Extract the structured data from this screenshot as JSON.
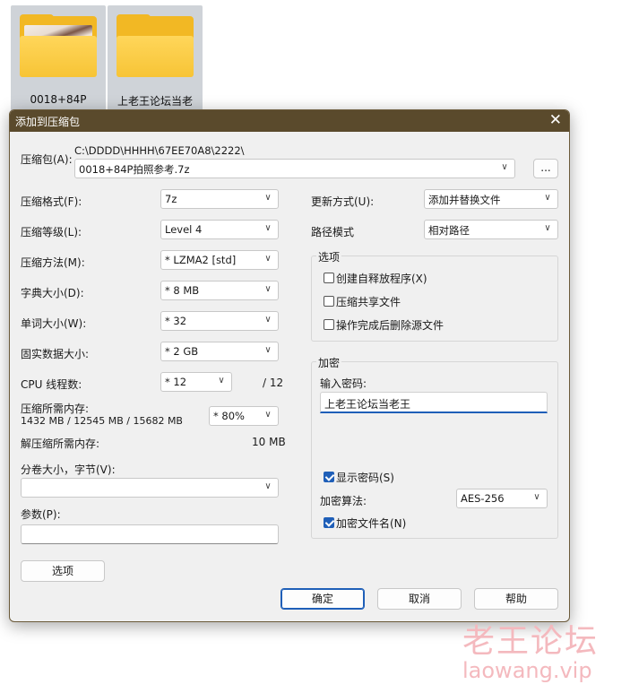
{
  "desktop": {
    "folders": [
      {
        "label": "0018+84P"
      },
      {
        "label": "上老王论坛当老"
      }
    ]
  },
  "dialog": {
    "title": "添加到压缩包",
    "close_glyph": "✕",
    "archive": {
      "label": "压缩包(A):",
      "path": "C:\\DDDD\\HHHH\\67EE70A8\\2222\\",
      "value": "0018+84P拍照参考.7z",
      "browse": "..."
    },
    "left": {
      "format": {
        "label": "压缩格式(F):",
        "value": "7z"
      },
      "level": {
        "label": "压缩等级(L):",
        "value": "Level 4"
      },
      "method": {
        "label": "压缩方法(M):",
        "value": "*  LZMA2 [std]"
      },
      "dict": {
        "label": "字典大小(D):",
        "value": "*  8 MB"
      },
      "word": {
        "label": "单词大小(W):",
        "value": "*  32"
      },
      "solid": {
        "label": "固实数据大小:",
        "value": "*  2 GB"
      },
      "threads": {
        "label": "CPU 线程数:",
        "value": "*  12",
        "total": "/ 12"
      },
      "mem_compress": {
        "label": "压缩所需内存:",
        "detail": "1432 MB / 12545 MB / 15682 MB",
        "value": "* 80%"
      },
      "mem_decompress": {
        "label": "解压缩所需内存:",
        "value": "10 MB"
      },
      "volume": {
        "label": "分卷大小，字节(V):",
        "value": ""
      },
      "params": {
        "label": "参数(P):",
        "value": ""
      },
      "options_button": "选项"
    },
    "right": {
      "update": {
        "label": "更新方式(U):",
        "value": "添加并替换文件"
      },
      "path_mode": {
        "label": "路径模式",
        "value": "相对路径"
      },
      "options_group": {
        "title": "选项",
        "items": [
          {
            "label": "创建自释放程序(X)",
            "checked": false
          },
          {
            "label": "压缩共享文件",
            "checked": false
          },
          {
            "label": "操作完成后删除源文件",
            "checked": false
          }
        ]
      },
      "encrypt_group": {
        "title": "加密",
        "password_label": "输入密码:",
        "password_value": "上老王论坛当老王",
        "show_password": {
          "label": "显示密码(S)",
          "checked": true
        },
        "method": {
          "label": "加密算法:",
          "value": "AES-256"
        },
        "encrypt_names": {
          "label": "加密文件名(N)",
          "checked": true
        }
      }
    },
    "buttons": {
      "ok": "确定",
      "cancel": "取消",
      "help": "帮助"
    }
  },
  "watermark": {
    "cn": "老王论坛",
    "url": "laowang.vip"
  },
  "colors": {
    "titlebar": "#5a4a2c",
    "accent": "#1f5fb8",
    "watermark": "#f4b9be"
  }
}
